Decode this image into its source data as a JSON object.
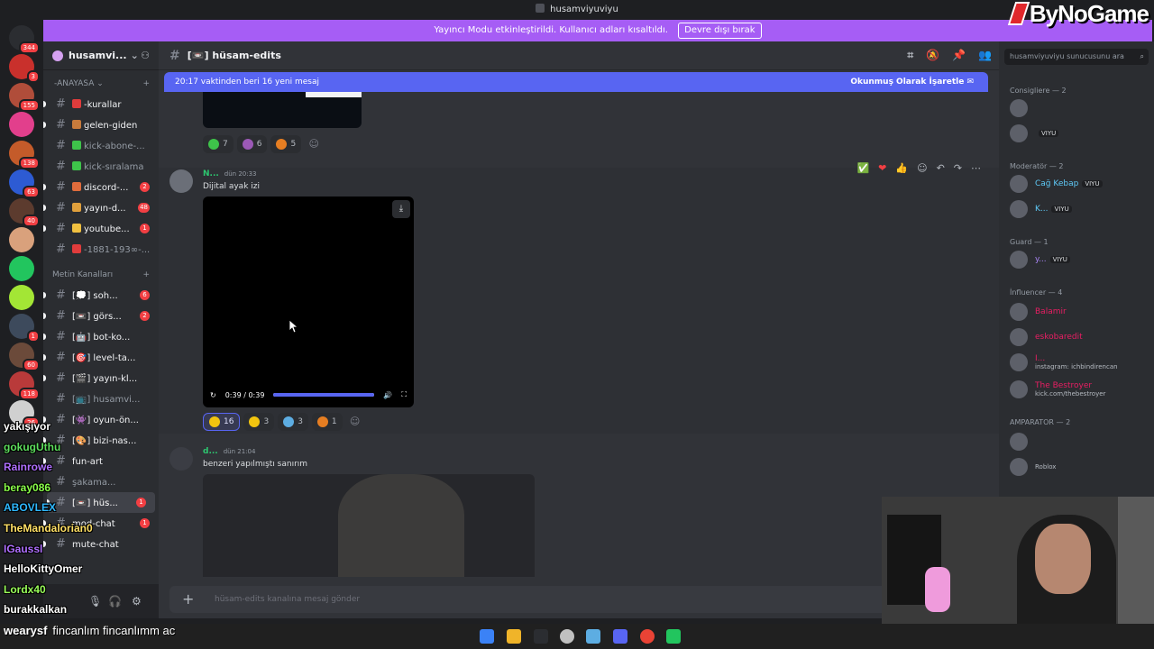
{
  "window": {
    "title": "husamviyuviyu"
  },
  "logo": {
    "text": "ByNoGame"
  },
  "streamer_banner": {
    "text": "Yayıncı Modu etkinleştirildi. Kullanıcı adları kısaltıldı.",
    "button": "Devre dışı bırak"
  },
  "servers": [
    {
      "badge": "344",
      "color": "#2b2d31"
    },
    {
      "badge": "3",
      "color": "#c9302c"
    },
    {
      "badge": "155",
      "color": "#b04d3a"
    },
    {
      "badge": "",
      "color": "#e23f8c"
    },
    {
      "badge": "138",
      "color": "#c45b2a"
    },
    {
      "badge": "63",
      "color": "#2d5bd3"
    },
    {
      "badge": "40",
      "color": "#5c3b2e"
    },
    {
      "badge": "",
      "color": "#d9a17c"
    },
    {
      "badge": "",
      "color": "#22c55e"
    },
    {
      "badge": "",
      "color": "#a3e635"
    },
    {
      "badge": "1",
      "color": "#3d4a5c"
    },
    {
      "badge": "60",
      "color": "#6b4a3a"
    },
    {
      "badge": "118",
      "color": "#b93a3a"
    },
    {
      "badge": "26",
      "color": "#d0d0d0"
    }
  ],
  "guild": {
    "name": "husamvi..."
  },
  "categories": {
    "cat1": "ANAYASA",
    "cat2": "Metin Kanalları"
  },
  "channels": [
    {
      "name": "-kurallar",
      "count": "",
      "unread": true,
      "color": "#e03c3c"
    },
    {
      "name": "gelen-giden",
      "count": "",
      "unread": true,
      "color": "#c77b3c"
    },
    {
      "name": "kick-abone-...",
      "count": "",
      "unread": false,
      "color": "#3ec34a"
    },
    {
      "name": "kick-sıralama",
      "count": "",
      "unread": false,
      "color": "#3ec34a"
    },
    {
      "name": "discord-...",
      "count": "2",
      "unread": true,
      "color": "#e06c3c"
    },
    {
      "name": "yayın-d...",
      "count": "48",
      "unread": true,
      "color": "#e0a03c"
    },
    {
      "name": "youtube...",
      "count": "1",
      "unread": true,
      "color": "#f0c040"
    },
    {
      "name": "-1881-193∞-...",
      "count": "",
      "unread": false,
      "color": "#e03c3c"
    }
  ],
  "channels2": [
    {
      "name": "[💭] soh...",
      "count": "6",
      "unread": true
    },
    {
      "name": "[📼] görs...",
      "count": "2",
      "unread": true
    },
    {
      "name": "[🤖] bot-ko...",
      "count": "",
      "unread": true
    },
    {
      "name": "[🎯] level-ta...",
      "count": "",
      "unread": true
    },
    {
      "name": "[🎬] yayın-kl...",
      "count": "",
      "unread": true
    },
    {
      "name": "[📺] husamvi...",
      "count": "",
      "unread": false
    },
    {
      "name": "[👾] oyun-ön...",
      "count": "",
      "unread": true
    },
    {
      "name": "[🎨] bizi-nas...",
      "count": "",
      "unread": true
    },
    {
      "name": "fun-art",
      "count": "",
      "unread": true
    },
    {
      "name": "şakama...",
      "count": "",
      "unread": false
    },
    {
      "name": "[📼] hüs...",
      "count": "1",
      "unread": true,
      "active": true
    },
    {
      "name": "mod-chat",
      "count": "1",
      "unread": true
    },
    {
      "name": "mute-chat",
      "count": "",
      "unread": true
    }
  ],
  "chat": {
    "channel_name": "[📼] hüsam-edits",
    "new_messages": "20:17 vaktinden beri 16 yeni mesaj",
    "mark_read": "Okunmuş Olarak İşaretle",
    "composer_placeholder": "hüsam-edits kanalına mesaj gönder"
  },
  "reactions_top": [
    {
      "count": "7",
      "color": "#3ec34a",
      "me": false
    },
    {
      "count": "6",
      "color": "#9b59b6",
      "me": false
    },
    {
      "count": "5",
      "color": "#e67e22",
      "me": false
    }
  ],
  "message1": {
    "author": "N...",
    "time": "dün 20:33",
    "text": "Dijital ayak izi"
  },
  "video": {
    "time": "0:39 / 0:39",
    "progress": 1.0
  },
  "reactions_msg1": [
    {
      "count": "16",
      "color": "#f1c40f",
      "me": true
    },
    {
      "count": "3",
      "color": "#f1c40f",
      "me": false
    },
    {
      "count": "3",
      "color": "#5dade2",
      "me": false
    },
    {
      "count": "1",
      "color": "#e67e22",
      "me": false
    }
  ],
  "message2": {
    "author": "d...",
    "time": "dün 21:04",
    "text": "benzeri yapılmıştı sanırım"
  },
  "members": {
    "search_placeholder": "husamviyuviyu sunucusunu ara",
    "roles": [
      {
        "label": "Consigliere — 2"
      },
      {
        "label": "Moderatör — 2"
      },
      {
        "label": "Guard — 1"
      },
      {
        "label": "İnfluencer — 4"
      },
      {
        "label": "AMPARATOR — 2"
      }
    ],
    "list": [
      {
        "name": "",
        "color": "#2d7d46",
        "tag": "",
        "sub": ""
      },
      {
        "name": "",
        "color": "#949ba4",
        "tag": "VIYU",
        "sub": ""
      },
      {
        "name": "Cağ Kebap",
        "color": "#5ec9f7",
        "tag": "VIYU",
        "sub": ""
      },
      {
        "name": "K...",
        "color": "#5ec9f7",
        "tag": "VIYU",
        "sub": ""
      },
      {
        "name": "y...",
        "color": "#a884f3",
        "tag": "VIYU",
        "sub": ""
      },
      {
        "name": "Balamir",
        "color": "#e91e63",
        "tag": "",
        "sub": ""
      },
      {
        "name": "eskobaredit",
        "color": "#e91e63",
        "tag": "",
        "sub": ""
      },
      {
        "name": "I...",
        "color": "#e91e63",
        "tag": "",
        "sub": "instagram: ichbindirencan"
      },
      {
        "name": "The Bestroyer",
        "color": "#e91e63",
        "tag": "",
        "sub": "kick.com/thebestroyer"
      },
      {
        "name": "",
        "color": "#2dc770",
        "tag": "",
        "sub": ""
      },
      {
        "name": "",
        "color": "#949ba4",
        "tag": "",
        "sub": "Roblox"
      }
    ]
  },
  "twitch_chat": [
    {
      "user": "yakışıyor",
      "color": "#ffffff",
      "msg": ""
    },
    {
      "user": "gokugUthu",
      "color": "#5ddd5d",
      "msg": ""
    },
    {
      "user": "Rainrowe",
      "color": "#b070ff",
      "msg": ""
    },
    {
      "user": "beray086",
      "color": "#8aff4a",
      "msg": ""
    },
    {
      "user": "ABOVLEX",
      "color": "#2fb8ff",
      "msg": ""
    },
    {
      "user": "TheMandalorian0",
      "color": "#ffe066",
      "msg": ""
    },
    {
      "user": "IGaussl",
      "color": "#b070ff",
      "msg": ""
    },
    {
      "user": "HelloKittyOmer",
      "color": "#ffffff",
      "msg": ""
    },
    {
      "user": "Lordx40",
      "color": "#9aff5a",
      "msg": ""
    },
    {
      "user": "burakkalkan",
      "color": "#ffffff",
      "msg": ""
    }
  ],
  "bottom_message": {
    "user": "wearysf",
    "msg": "fincanlım fincanlımm ac"
  },
  "colors": {
    "accent": "#5865f2",
    "banner": "#a65df5",
    "unread_badge": "#f23f43"
  }
}
